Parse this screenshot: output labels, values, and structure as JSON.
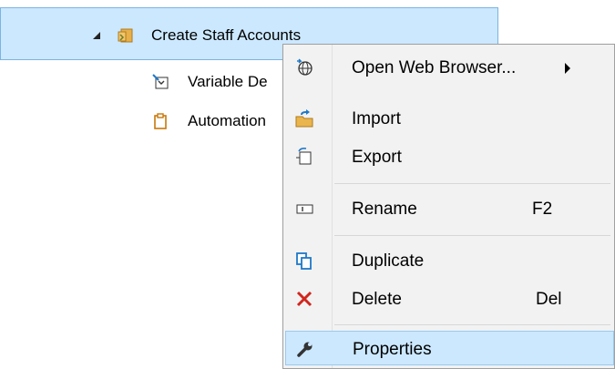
{
  "tree": {
    "root": {
      "label": "Create Staff Accounts",
      "icon": "folder-script-icon"
    },
    "children": [
      {
        "label": "Variable De",
        "icon": "variable-definition-icon"
      },
      {
        "label": "Automation",
        "icon": "clipboard-icon"
      }
    ]
  },
  "context_menu": {
    "items": [
      {
        "label": "Open Web Browser...",
        "icon": "globe-icon",
        "has_submenu": true
      },
      {
        "label": "Import",
        "icon": "import-icon"
      },
      {
        "label": "Export",
        "icon": "export-icon"
      },
      {
        "label": "Rename",
        "icon": "rename-icon",
        "shortcut": "F2"
      },
      {
        "label": "Duplicate",
        "icon": "duplicate-icon"
      },
      {
        "label": "Delete",
        "icon": "delete-icon",
        "shortcut": "Del"
      },
      {
        "label": "Properties",
        "icon": "wrench-icon"
      }
    ]
  },
  "colors": {
    "selection": "#cce8ff",
    "selection_border": "#7ab4df",
    "menu_bg": "#f2f2f2",
    "delete_red": "#d0261e",
    "duplicate_blue": "#1e78c8"
  }
}
